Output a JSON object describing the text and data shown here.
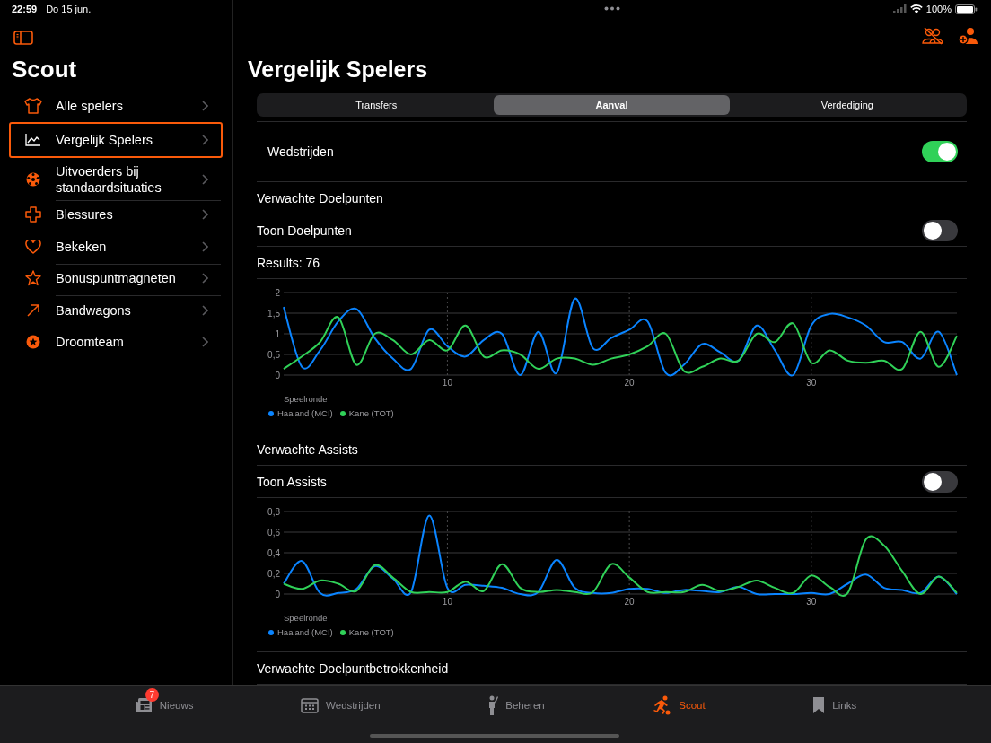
{
  "status_bar": {
    "time": "22:59",
    "date": "Do 15 jun.",
    "battery": "100%"
  },
  "sidebar": {
    "title": "Scout",
    "items": [
      {
        "label": "Alle spelers",
        "selected": false
      },
      {
        "label": "Vergelijk Spelers",
        "selected": true
      },
      {
        "label": "Uitvoerders bij standaardsituaties",
        "selected": false
      },
      {
        "label": "Blessures",
        "selected": false
      },
      {
        "label": "Bekeken",
        "selected": false
      },
      {
        "label": "Bonuspuntmagneten",
        "selected": false
      },
      {
        "label": "Bandwagons",
        "selected": false
      },
      {
        "label": "Droomteam",
        "selected": false
      }
    ]
  },
  "main": {
    "title": "Vergelijk Spelers",
    "segments": [
      {
        "label": "Transfers",
        "selected": false
      },
      {
        "label": "Aanval",
        "selected": true
      },
      {
        "label": "Verdediging",
        "selected": false
      }
    ],
    "toggle_row": {
      "label": "Wedstrijden",
      "on": true
    },
    "sections": [
      {
        "title": "Verwachte Doelpunten",
        "toggle": {
          "label": "Toon Doelpunten",
          "on": false
        },
        "results": "Results: 76",
        "chart_data": {
          "type": "line",
          "grid": true,
          "legend": true,
          "xlabel": "Speelronde",
          "x": [
            1,
            2,
            3,
            4,
            5,
            6,
            7,
            8,
            9,
            10,
            11,
            12,
            13,
            14,
            15,
            16,
            17,
            18,
            19,
            20,
            21,
            22,
            23,
            24,
            25,
            26,
            27,
            28,
            29,
            30,
            31,
            32,
            33,
            34,
            35,
            36,
            37,
            38
          ],
          "xlim": [
            1,
            38
          ],
          "ylim": [
            0,
            2
          ],
          "xticks": [
            10,
            20,
            30
          ],
          "yticks": [
            0,
            {
              "value": 0.5,
              "label": "0,5"
            },
            1,
            {
              "value": 1.5,
              "label": "1,5"
            },
            2
          ],
          "series": [
            {
              "name": "Haaland (MCI)",
              "color": "#0a84ff",
              "values": [
                1.65,
                0.2,
                0.6,
                1.3,
                1.6,
                0.9,
                0.4,
                0.15,
                1.1,
                0.7,
                0.45,
                0.85,
                1.0,
                0.0,
                1.05,
                0.05,
                1.85,
                0.65,
                0.9,
                1.1,
                1.3,
                0.05,
                0.25,
                0.75,
                0.55,
                0.35,
                1.2,
                0.6,
                0.0,
                1.2,
                1.48,
                1.4,
                1.2,
                0.8,
                0.8,
                0.4,
                1.05,
                0.0
              ]
            },
            {
              "name": "Kane (TOT)",
              "color": "#30d158",
              "values": [
                0.15,
                0.45,
                0.8,
                1.4,
                0.25,
                1.0,
                0.85,
                0.5,
                0.85,
                0.6,
                1.2,
                0.45,
                0.6,
                0.5,
                0.15,
                0.4,
                0.4,
                0.25,
                0.4,
                0.5,
                0.7,
                1.0,
                0.1,
                0.2,
                0.4,
                0.35,
                1.0,
                0.8,
                1.25,
                0.3,
                0.6,
                0.35,
                0.3,
                0.35,
                0.15,
                1.05,
                0.2,
                0.95
              ]
            }
          ]
        }
      },
      {
        "title": "Verwachte Assists",
        "toggle": {
          "label": "Toon Assists",
          "on": false
        },
        "chart_data": {
          "type": "line",
          "grid": true,
          "legend": true,
          "xlabel": "Speelronde",
          "x": [
            1,
            2,
            3,
            4,
            5,
            6,
            7,
            8,
            9,
            10,
            11,
            12,
            13,
            14,
            15,
            16,
            17,
            18,
            19,
            20,
            21,
            22,
            23,
            24,
            25,
            26,
            27,
            28,
            29,
            30,
            31,
            32,
            33,
            34,
            35,
            36,
            37,
            38
          ],
          "xlim": [
            1,
            38
          ],
          "ylim": [
            0,
            0.8
          ],
          "xticks": [
            10,
            20,
            30
          ],
          "yticks": [
            0,
            {
              "value": 0.2,
              "label": "0,2"
            },
            {
              "value": 0.4,
              "label": "0,4"
            },
            {
              "value": 0.6,
              "label": "0,6"
            },
            {
              "value": 0.8,
              "label": "0,8"
            }
          ],
          "series": [
            {
              "name": "Haaland (MCI)",
              "color": "#0a84ff",
              "values": [
                0.1,
                0.32,
                0.01,
                0.01,
                0.05,
                0.27,
                0.15,
                0.02,
                0.76,
                0.06,
                0.09,
                0.08,
                0.06,
                0.0,
                0.02,
                0.33,
                0.06,
                0.01,
                0.01,
                0.05,
                0.05,
                0.01,
                0.04,
                0.03,
                0.02,
                0.07,
                0.0,
                0.0,
                0.0,
                0.01,
                0.0,
                0.1,
                0.19,
                0.06,
                0.04,
                0.01,
                0.17,
                0.0
              ]
            },
            {
              "name": "Kane (TOT)",
              "color": "#30d158",
              "values": [
                0.1,
                0.05,
                0.13,
                0.1,
                0.03,
                0.28,
                0.16,
                0.02,
                0.02,
                0.02,
                0.12,
                0.03,
                0.29,
                0.06,
                0.02,
                0.04,
                0.02,
                0.02,
                0.29,
                0.16,
                0.02,
                0.02,
                0.02,
                0.09,
                0.03,
                0.07,
                0.13,
                0.06,
                0.01,
                0.18,
                0.07,
                0.01,
                0.53,
                0.47,
                0.22,
                0.0,
                0.17,
                0.01
              ]
            }
          ]
        }
      },
      {
        "title": "Verwachte Doelpuntbetrokkenheid"
      }
    ]
  },
  "tab_bar": [
    {
      "label": "Nieuws",
      "selected": false,
      "badge": "7"
    },
    {
      "label": "Wedstrijden",
      "selected": false
    },
    {
      "label": "Beheren",
      "selected": false
    },
    {
      "label": "Scout",
      "selected": true
    },
    {
      "label": "Links",
      "selected": false
    }
  ]
}
